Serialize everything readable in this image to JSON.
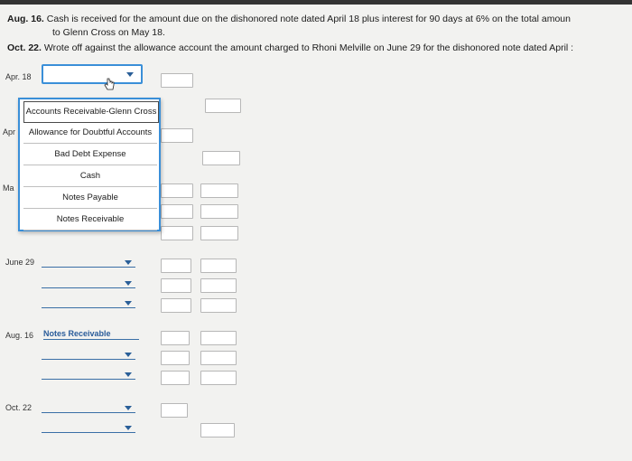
{
  "instructions": {
    "aug16_label": "Aug. 16.",
    "aug16_line1": "Cash is received for the amount due on the dishonored note dated April 18 plus interest for 90 days at 6% on the total amoun",
    "aug16_line2": "to Glenn Cross on May 18.",
    "oct22_label": "Oct. 22.",
    "oct22_line1": "Wrote off against the allowance account the amount charged to Rhoni Melville on June 29 for the dishonored note dated April :"
  },
  "entries": {
    "apr18_date": "Apr. 18",
    "apr_partial": "Apr",
    "may_partial": "Ma",
    "june29_date": "June 29",
    "aug16_date": "Aug. 16",
    "aug16_selected_account": "Notes Receivable",
    "oct22_date": "Oct. 22"
  },
  "dropdown": {
    "options": [
      "Accounts Receivable-Glenn Cross",
      "Allowance for Doubtful Accounts",
      "Bad Debt Expense",
      "Cash",
      "Notes Payable",
      "Notes Receivable"
    ]
  },
  "colors": {
    "focus_border": "#3a8fd8",
    "selected_text": "#2a5c9a"
  }
}
